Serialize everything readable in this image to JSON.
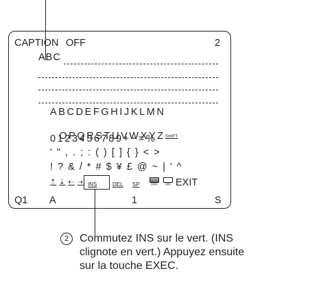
{
  "screen": {
    "caption_label": "CAPTION",
    "caption_state": "OFF",
    "page_number": "2",
    "caption_text": "ABC",
    "char_rows": [
      "ABCDEFGHIJKLMN",
      "OPQRSTUVWXYZ",
      "0123456789+−=%",
      "' \" , . ; : ( ) [ ] { } < >",
      "! ? & / * # $ ¥ £ @ ~ | ' ^"
    ],
    "shift_key": "SHIFT",
    "edit_keys": {
      "ins": "INS",
      "del": "DEL",
      "sp": "SP",
      "off": "OFF",
      "on": "ON",
      "exit": "EXIT"
    },
    "status": {
      "q": "Q1",
      "a": "A",
      "one": "1",
      "s": "S"
    }
  },
  "callout": {
    "number": "2",
    "text": "Commutez INS sur le vert. (INS clignote en vert.) Appuyez ensuite sur la touche EXEC.",
    "line1": "Commutez INS sur le vert. (INS",
    "line2": "clignote en vert.) Appuyez ensuite",
    "line3": "sur la touche EXEC."
  }
}
